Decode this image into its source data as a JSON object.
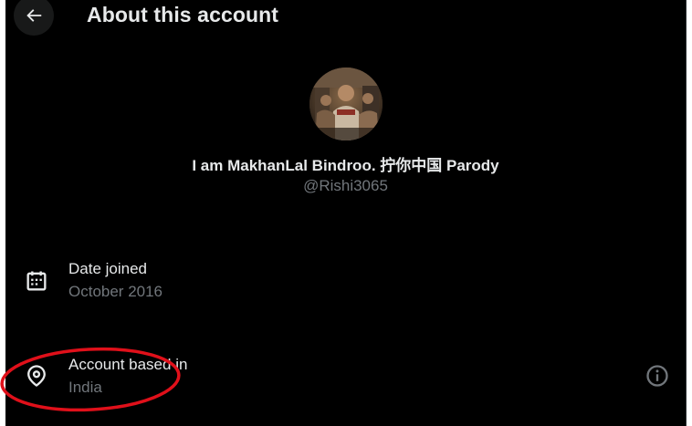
{
  "header": {
    "title": "About this account",
    "back_icon": "arrow-left-icon"
  },
  "profile": {
    "display_name": "I am MakhanLal Bindroo. 拧你中国 Parody",
    "handle": "@Rishi3065"
  },
  "details": [
    {
      "icon": "calendar-icon",
      "label": "Date joined",
      "value": "October 2016"
    },
    {
      "icon": "location-pin-icon",
      "label": "Account based in",
      "value": "India",
      "trailing_icon": "info-icon"
    }
  ],
  "colors": {
    "background": "#000000",
    "primary_text": "#e7e9ea",
    "secondary_text": "#71767b",
    "annotation": "#e0101a"
  }
}
